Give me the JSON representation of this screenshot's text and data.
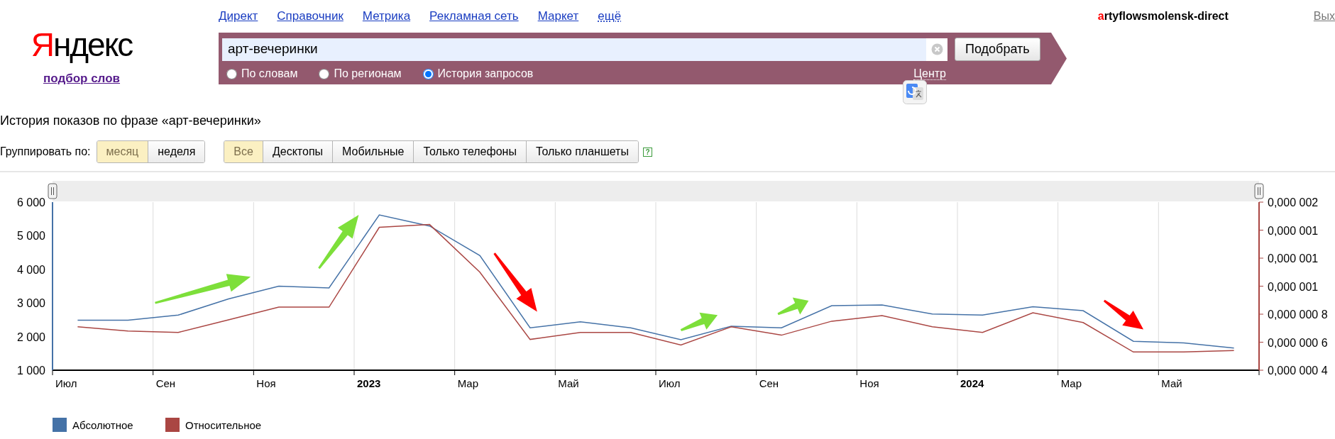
{
  "header": {
    "logo": "Яндекс",
    "logo_subtitle": "подбор слов",
    "nav_links": [
      {
        "label": "Директ",
        "kind": "link"
      },
      {
        "label": "Справочник",
        "kind": "link"
      },
      {
        "label": "Метрика",
        "kind": "link"
      },
      {
        "label": "Рекламная сеть",
        "kind": "link"
      },
      {
        "label": "Маркет",
        "kind": "link"
      },
      {
        "label": "ещё",
        "kind": "more"
      }
    ],
    "user": "artyflowsmolensk-direct",
    "logout": "Вых"
  },
  "search": {
    "value": "арт-вечеринки",
    "button": "Подобрать",
    "region": "Центр",
    "modes": [
      {
        "label": "По словам",
        "selected": false
      },
      {
        "label": "По регионам",
        "selected": false
      },
      {
        "label": "История запросов",
        "selected": true
      }
    ]
  },
  "title": "История показов по фразе «арт-вечеринки»",
  "grouping": {
    "label": "Группировать по:",
    "options": [
      {
        "label": "месяц",
        "selected": true
      },
      {
        "label": "неделя",
        "selected": false
      }
    ]
  },
  "devices": [
    {
      "label": "Все",
      "selected": true
    },
    {
      "label": "Десктопы",
      "selected": false
    },
    {
      "label": "Мобильные",
      "selected": false
    },
    {
      "label": "Только телефоны",
      "selected": false
    },
    {
      "label": "Только планшеты",
      "selected": false
    }
  ],
  "help": "?",
  "chart_data": {
    "type": "line",
    "categories": [
      "Июл",
      null,
      "Сен",
      null,
      "Ноя",
      null,
      "**2023**",
      null,
      "Мар",
      null,
      "Май",
      null,
      "Июл",
      null,
      "Сен",
      null,
      "Ноя",
      null,
      "**2024**",
      null,
      "Мар",
      null,
      "Май",
      null
    ],
    "legend": "bottom",
    "ylim": [
      1000,
      6000
    ],
    "yticks": [
      {
        "value": 1000,
        "label": "1 000"
      },
      {
        "value": 2000,
        "label": "2 000"
      },
      {
        "value": 3000,
        "label": "3 000"
      },
      {
        "value": 4000,
        "label": "4 000"
      },
      {
        "value": 5000,
        "label": "5 000"
      },
      {
        "value": 6000,
        "label": "6 000"
      }
    ],
    "y2lim": [
      4e-07,
      1.6e-06
    ],
    "y2ticks": [
      {
        "value": 4e-07,
        "label": "0,000 000 4"
      },
      {
        "value": 6e-07,
        "label": "0,000 000 6"
      },
      {
        "value": 8e-07,
        "label": "0,000 000 8"
      },
      {
        "value": 1e-06,
        "label": "0,000 001"
      },
      {
        "value": 1.2e-06,
        "label": "0,000 001"
      },
      {
        "value": 1.4e-06,
        "label": "0,000 001"
      },
      {
        "value": 1.6e-06,
        "label": "0,000 002"
      }
    ],
    "series": [
      {
        "name": "Абсолютное",
        "color": "#4572a7",
        "values": [
          2490,
          2490,
          2640,
          3120,
          3500,
          3450,
          5620,
          5290,
          4410,
          2260,
          2440,
          2260,
          1910,
          2310,
          2260,
          2920,
          2940,
          2670,
          2640,
          2890,
          2770,
          1860,
          1810,
          1660
        ]
      },
      {
        "name": "Относительное",
        "color": "#aa4643",
        "axis": "y2",
        "values": [
          7.1e-07,
          6.8e-07,
          6.7e-07,
          7.6e-07,
          8.5e-07,
          8.5e-07,
          1.42e-06,
          1.44e-06,
          1.1e-06,
          6.2e-07,
          6.7e-07,
          6.7e-07,
          5.8e-07,
          7.1e-07,
          6.5e-07,
          7.5e-07,
          7.9e-07,
          7.1e-07,
          6.7e-07,
          8.1e-07,
          7.4e-07,
          5.3e-07,
          5.3e-07,
          5.4e-07
        ]
      }
    ]
  },
  "markup_arrows": [
    {
      "color": "#7ddf3a"
    },
    {
      "color": "#7ddf3a"
    },
    {
      "color": "#ff0000"
    },
    {
      "color": "#7ddf3a"
    },
    {
      "color": "#7ddf3a"
    },
    {
      "color": "#ff0000"
    }
  ]
}
